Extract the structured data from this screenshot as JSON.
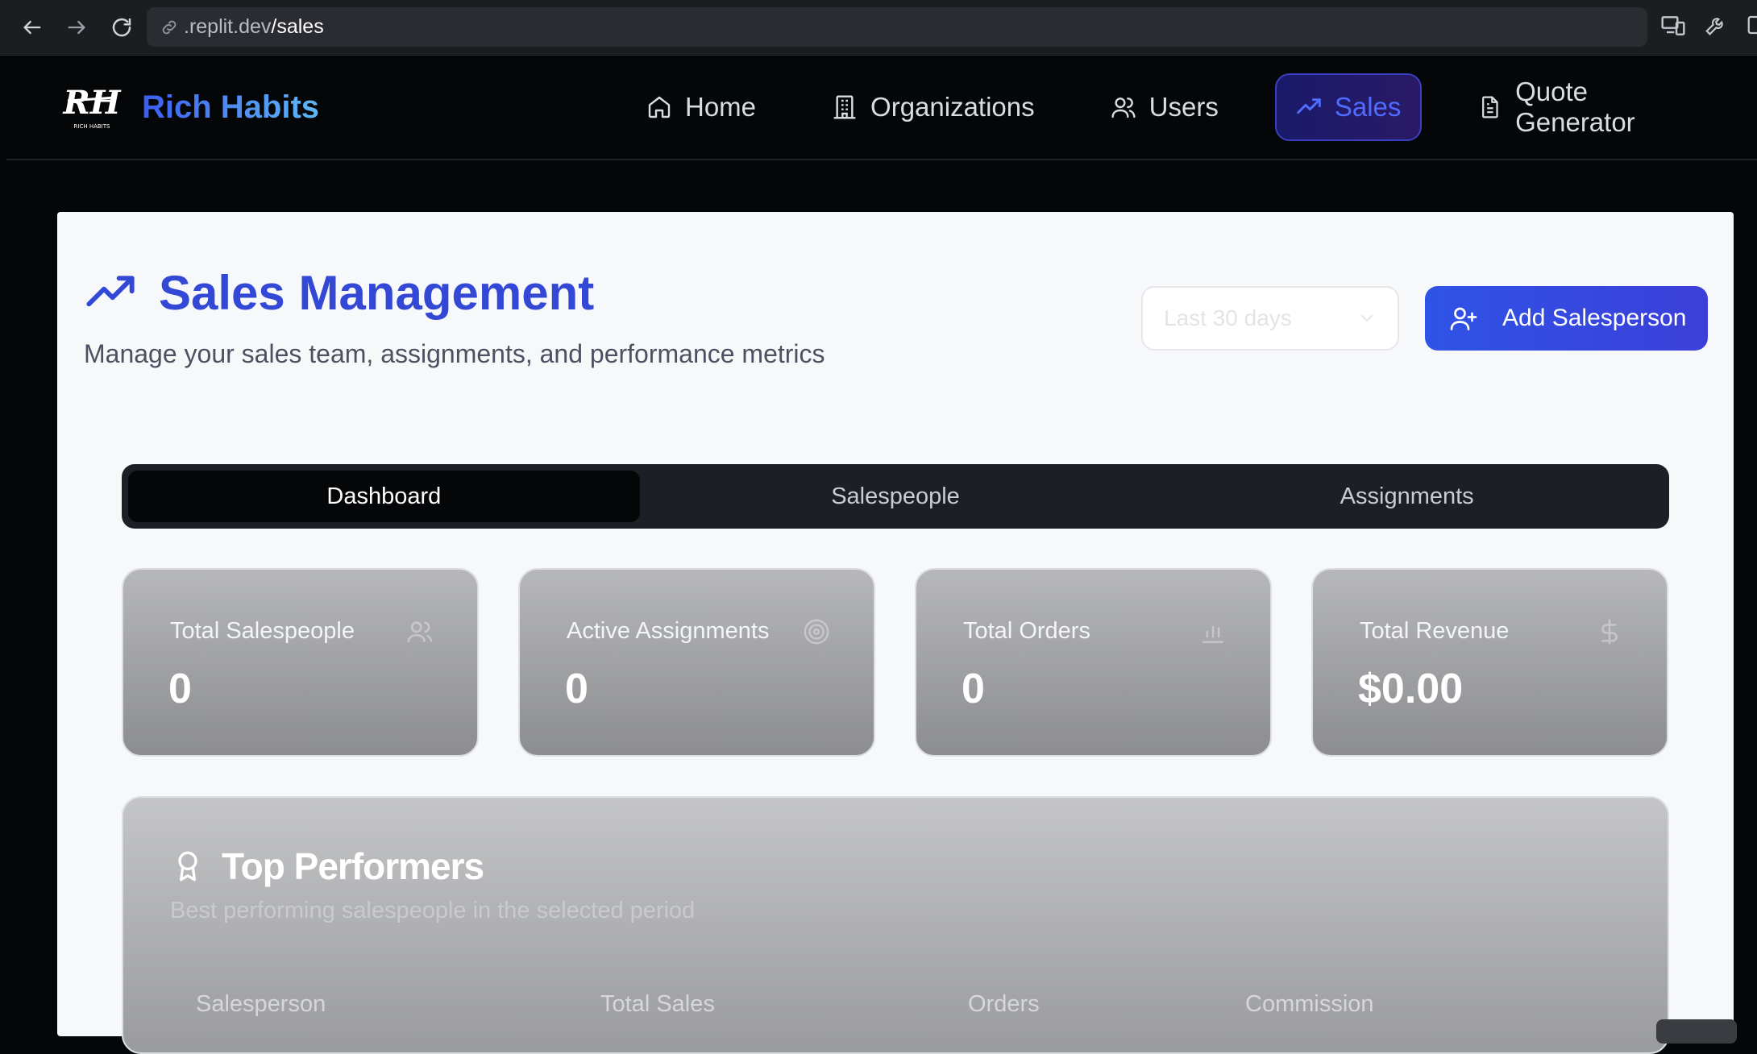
{
  "browser": {
    "url_host": ".replit.dev",
    "url_path": "/sales"
  },
  "brand": {
    "name": "Rich Habits",
    "logo_text": "RH",
    "logo_caption": "RICH HABITS"
  },
  "nav": {
    "items": [
      {
        "label": "Home",
        "icon": "home-icon"
      },
      {
        "label": "Organizations",
        "icon": "building-icon"
      },
      {
        "label": "Users",
        "icon": "users-icon"
      },
      {
        "label": "Sales",
        "icon": "trending-up-icon",
        "active": true
      },
      {
        "label": "Quote Generator",
        "icon": "file-text-icon"
      }
    ]
  },
  "page": {
    "title": "Sales Management",
    "subtitle": "Manage your sales team, assignments, and performance metrics",
    "period_select": "Last 30 days",
    "add_button": "Add Salesperson"
  },
  "tabs": [
    {
      "label": "Dashboard",
      "active": true
    },
    {
      "label": "Salespeople"
    },
    {
      "label": "Assignments"
    }
  ],
  "stats": [
    {
      "label": "Total Salespeople",
      "value": "0",
      "icon": "users-icon"
    },
    {
      "label": "Active Assignments",
      "value": "0",
      "icon": "target-icon"
    },
    {
      "label": "Total Orders",
      "value": "0",
      "icon": "bar-chart-icon"
    },
    {
      "label": "Total Revenue",
      "value": "$0.00",
      "icon": "dollar-icon"
    }
  ],
  "performers": {
    "title": "Top Performers",
    "subtitle": "Best performing salespeople in the selected period",
    "columns": [
      "Salesperson",
      "Total Sales",
      "Orders",
      "Commission"
    ]
  },
  "colors": {
    "accent": "#3349d6",
    "button": "#2f53e6",
    "header_bg": "#050608",
    "panel_bg": "#f7f8fa"
  }
}
